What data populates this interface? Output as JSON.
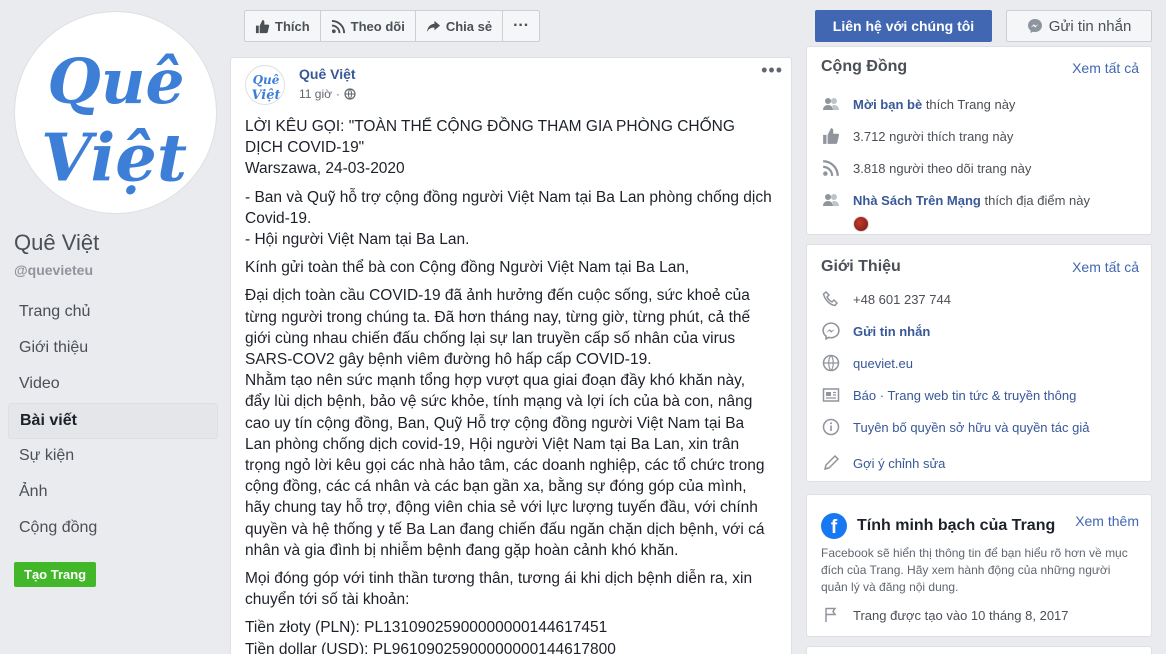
{
  "page": {
    "name": "Quê Việt",
    "handle": "@quevieteu",
    "logo_text_line1": "Quê",
    "logo_text_line2": "Việt"
  },
  "nav": {
    "items": [
      {
        "label": "Trang chủ"
      },
      {
        "label": "Giới thiệu"
      },
      {
        "label": "Video"
      },
      {
        "label": "Bài viết"
      },
      {
        "label": "Sự kiện"
      },
      {
        "label": "Ảnh"
      },
      {
        "label": "Cộng đồng"
      }
    ],
    "active_index": 3,
    "create_page": "Tạo Trang"
  },
  "actions": {
    "like": "Thích",
    "follow": "Theo dõi",
    "share": "Chia sẻ",
    "more": "···",
    "contact": "Liên hệ với chúng tôi",
    "message": "Gửi tin nhắn"
  },
  "post": {
    "author": "Quê Việt",
    "time": "11 giờ",
    "separator": "·",
    "more": "•••",
    "paragraphs": [
      [
        "LỜI KÊU GỌI: \"TOÀN THỂ CỘNG ĐỒNG THAM GIA PHÒNG CHỐNG",
        "DỊCH COVID-19\"",
        "Warszawa, 24-03-2020"
      ],
      [
        "- Ban và Quỹ hỗ trợ cộng đồng người Việt Nam tại Ba Lan phòng chống dịch",
        "Covid-19.",
        "- Hội người Việt Nam tại Ba Lan."
      ],
      [
        "Kính gửi toàn thể bà con Cộng đồng Người Việt Nam tại Ba Lan,"
      ],
      [
        "Đại dịch toàn cầu COVID-19 đã ảnh hưởng đến cuộc sống, sức khoẻ của",
        "từng người trong chúng ta. Đã hơn tháng nay, từng giờ, từng phút, cả thế",
        "giới cùng nhau chiến đấu chống lại sự lan truyền cấp số nhân của virus",
        "SARS-COV2 gây bệnh viêm đường hô hấp cấp COVID-19.",
        "Nhằm tạo nên sức mạnh tổng hợp vượt qua giai đoạn đầy khó khăn này,",
        "đẩy lùi dịch bệnh, bảo vệ sức khỏe, tính mạng và lợi ích của bà con, nâng",
        "cao uy tín cộng đồng, Ban, Quỹ Hỗ trợ cộng đồng người Việt Nam tại Ba",
        "Lan phòng chống dịch covid-19, Hội người Việt Nam tại Ba Lan, xin trân",
        "trọng ngỏ lời kêu gọi các nhà hảo tâm, các doanh nghiệp, các tổ chức trong",
        "cộng đồng, các cá nhân và các bạn gần xa, bằng sự đóng góp của mình,",
        "hãy chung tay hỗ trợ, động viên chia sẻ với lực lượng tuyến đầu, với chính",
        "quyền và hệ thống y tế Ba Lan đang chiến đấu ngăn chặn dịch bệnh, với cá",
        "nhân và gia đình bị nhiễm bệnh đang gặp hoàn cảnh khó khăn."
      ],
      [
        "Mọi đóng góp với tinh thần tương thân, tương ái khi dịch bệnh diễn ra, xin",
        "chuyển tới số tài khoản:"
      ],
      [
        "Tiền złoty (PLN): PL13109025900000000144617451",
        "Tiền dollar (USD): PL96109025900000000144617800"
      ]
    ]
  },
  "community": {
    "title": "Cộng Đồng",
    "see_all": "Xem tất cả",
    "invite_link": "Mời bạn bè",
    "invite_suffix": " thích Trang này",
    "likes": "3.712 người thích trang này",
    "follows": "3.818 người theo dõi trang này",
    "friend_name": "Nhà Sách Trên Mạng",
    "friend_suffix": " thích địa điểm này"
  },
  "about": {
    "title": "Giới Thiệu",
    "see_all": "Xem tất cả",
    "phone": "+48 601 237 744",
    "message": "Gửi tin nhắn",
    "website": "queviet.eu",
    "category": "Báo · Trang web tin tức & truyền thông",
    "ip_notice": "Tuyên bố quyền sở hữu và quyền tác giả",
    "suggest_edit": "Gợi ý chỉnh sửa"
  },
  "transparency": {
    "title": "Tính minh bạch của Trang",
    "see_more": "Xem thêm",
    "description": "Facebook sẽ hiển thị thông tin để bạn hiểu rõ hơn về mục đích của Trang. Hãy xem hành động của những người quản lý và đăng nội dung.",
    "created": "Trang được tạo vào 10 tháng 8, 2017"
  },
  "colors": {
    "brand_blue": "#4267b2",
    "link_blue": "#385898",
    "green": "#42b72a",
    "logo_blue": "#3d7fd6"
  }
}
